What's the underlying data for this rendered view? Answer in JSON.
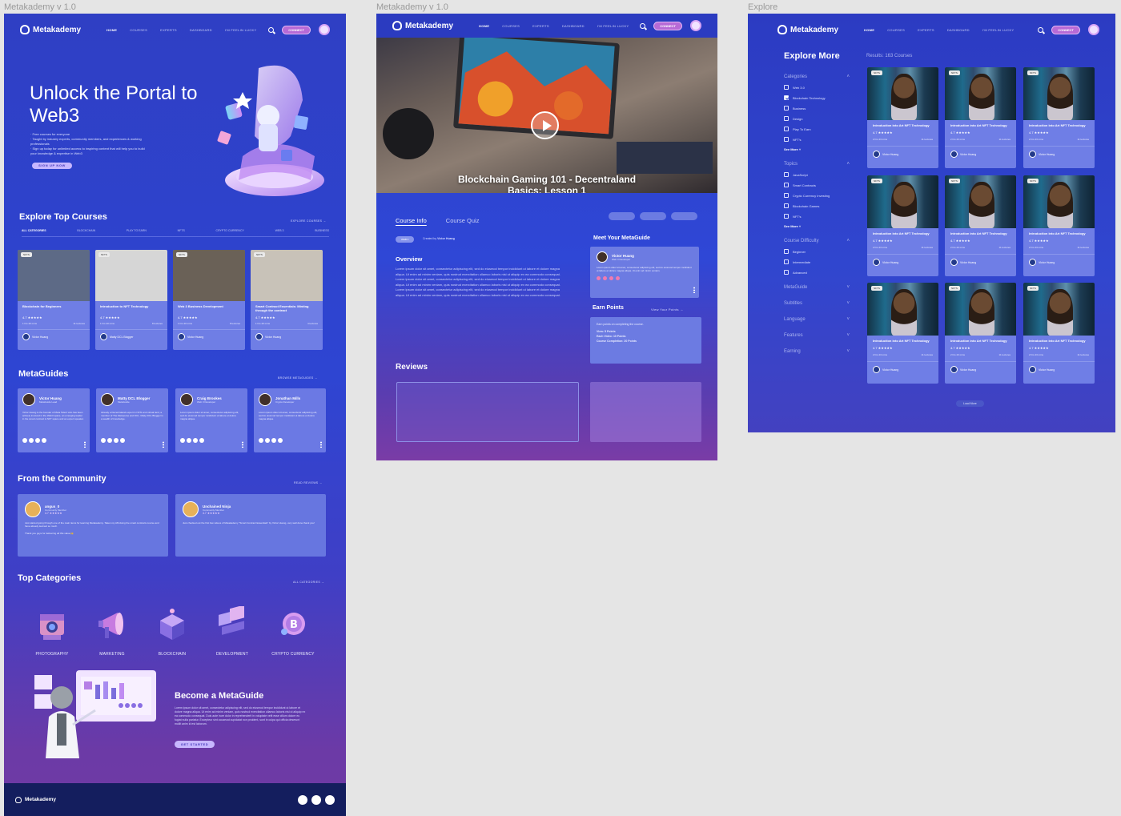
{
  "frames": {
    "home_label": "Metakademy v 1.0",
    "course_label": "Metakademy v 1.0",
    "explore_label": "Explore"
  },
  "nav": {
    "brand": "Metakademy",
    "links": [
      "HOME",
      "COURSES",
      "EXPERTS",
      "DASHBOARD",
      "I'M FEELIN LUCKY"
    ],
    "connect": "CONNECT"
  },
  "hero": {
    "title": "Unlock the Portal to Web3",
    "bullets": [
      "Free courses for everyone",
      "Taught by industry experts, community members, and experiences & working professionals",
      "Sign up today for unlimited access to inspiring content that will help you to build your knowledge & expertise in Web3"
    ],
    "cta": "SIGN UP NOW"
  },
  "top_courses": {
    "title": "Explore Top Courses",
    "link": "EXPLORE COURSES →",
    "tabs": [
      "ALL CATEGORIES",
      "BLOCKCHAIN",
      "PLAY TO EARN",
      "NFTS",
      "CRYPTO CURRENCY",
      "WEB 3",
      "BUSINESS"
    ],
    "cards": [
      {
        "tag": "NFTS",
        "title": "Blockchain for Beginners",
        "rating": "4.7 ★★★★★",
        "duration": "1 hrs 20 mins",
        "lectures": "11 lectures",
        "author": "Victor Huang",
        "thumb": "#5d6a86"
      },
      {
        "tag": "NFTS",
        "title": "Introduction to NFT Technology",
        "rating": "4.7 ★★★★★",
        "duration": "1 hrs 20 mins",
        "lectures": "8 lectures",
        "author": "Matty DCL Blogger",
        "thumb": "#d6d6d6"
      },
      {
        "tag": "NFTS",
        "title": "Web 3 Business Development",
        "rating": "4.7 ★★★★★",
        "duration": "1 hrs 20 mins",
        "lectures": "8 lectures",
        "author": "Victor Huang",
        "thumb": "#6a6157"
      },
      {
        "tag": "NFTS",
        "title": "Smart Contract Essentials: Minting through the contract",
        "rating": "4.7 ★★★★★",
        "duration": "1 hrs 20 mins",
        "lectures": "4 lectures",
        "author": "Victor Huang",
        "thumb": "#c8c2b8"
      }
    ]
  },
  "metaguides": {
    "title": "MetaGuides",
    "link": "BROWSE METAGUIDES →",
    "cards": [
      {
        "name": "Victor Huang",
        "sub": "MetaGuide Lead",
        "body": "Victor Huang is the founder of Meta Talent who has been actively involved in the Web3 space, an emerging leader in the smart contract & NFT space and an expert speaker."
      },
      {
        "name": "Matty DCL Blogger",
        "sub": "MetaGuide",
        "body": "Already a Decentraland expert in NFTs and virtual land, a member of The Metaverse and DCL. Matty DCL Blogger is a wealth of knowledge."
      },
      {
        "name": "Craig Brookes",
        "sub": "Web 3 Developer",
        "body": "Lorem ipsum dolor sit amet, consectetur adipiscing elit, sed do eiusmod tempor incididunt ut labore et dolore magna aliqua."
      },
      {
        "name": "Jonathan Mills",
        "sub": "Crypto Developer",
        "body": "Lorem ipsum dolor sit amet, consectetur adipiscing elit, sed do eiusmod tempor incididunt ut labore et dolore magna aliqua."
      }
    ]
  },
  "community": {
    "title": "From the Community",
    "link": "READ REVIEWS →",
    "reviews": [
      {
        "name": "angus_0",
        "sub": "Community Member",
        "rating": "4.7 ★★★★★",
        "body": "Just started going through one of the main items for learning Metakademy. Taken my AM doing the smart contracts course and have already learned so much.",
        "extra": "Thank you guys for delivering all this value 🙌"
      },
      {
        "name": "Unchained Ninja",
        "sub": "Community Member",
        "rating": "4.7 ★★★★★",
        "body": "Just checked out the first few videos of Metakademy \"Smart Contract Essentials\" by Victor Huang, very well done thank you!",
        "extra": ""
      }
    ]
  },
  "categories": {
    "title": "Top Categories",
    "link": "ALL CATEGORIES →",
    "items": [
      "PHOTOGRAPHY",
      "MARKETING",
      "BLOCKCHAIN",
      "DEVELOPMENT",
      "CRYPTO CURRENCY"
    ]
  },
  "become": {
    "title": "Become a MetaGuide",
    "body": "Lorem ipsum dolor sit amet, consectetur adipiscing elit, sed do eiusmod tempor incididunt ut labore et dolore magna aliqua. Ut enim ad minim veniam, quis nostrud exercitation ullamco laboris nisi ut aliquip ex ea commodo consequat. Duis aute irure dolor in reprehenderit in voluptate velit esse cillum dolore eu fugiat nulla pariatur. Excepteur sint occaecat cupidatat non proident, sunt in culpa qui officia deserunt mollit anim id est laborum.",
    "cta": "GET STARTED"
  },
  "footer": {
    "brand": "Metakademy"
  },
  "course_page": {
    "video_title": "Blockchain Gaming 101 - Decentraland Basics: Lesson 1",
    "tabs": [
      "Course Info",
      "Course Quiz"
    ],
    "tag": "WEB 3",
    "created_by": "Created by",
    "creator": "Victor Huang",
    "overview_title": "Overview",
    "overview": "Lorem ipsum dolor sit amet, consectetur adipiscing elit, sed do eiusmod tempor incididunt ut labore et dolore magna aliqua. Ut enim ad minim veniam, quis nostrud exercitation ullamco laboris nisi ut aliquip ex ea commodo consequat. Lorem ipsum dolor sit amet, consectetur adipiscing elit, sed do eiusmod tempor incididunt ut labore et dolore magna aliqua. Ut enim ad minim veniam, quis nostrud exercitation ullamco laboris nisi ut aliquip ex ea commodo consequat. Lorem ipsum dolor sit amet, consectetur adipiscing elit, sed do eiusmod tempor incididunt ut labore et dolore magna aliqua. Ut enim ad minim veniam, quis nostrud exercitation ullamco laboris nisi ut aliquip ex ea commodo consequat.",
    "meet_title": "Meet Your MetaGuide",
    "guide_name": "Victor Huang",
    "guide_sub": "Web 3 Developer",
    "guide_body": "Lorem ipsum dolor sit amet, consectetur adipiscing elit, sed do eiusmod tempor incididunt ut labore et dolore magna aliqua. Ut enim ad minim veniam.",
    "earn_title": "Earn Points",
    "earn_link": "View Your Points →",
    "earn_intro": "Earn points on completing the course.",
    "earn_view": "View: 5 Points",
    "earn_video": "Each Video: 10 Points",
    "earn_complete": "Course Completion: 20 Points",
    "reviews_title": "Reviews"
  },
  "explore": {
    "title": "Explore More",
    "results": "Results: 163 Courses",
    "categories_title": "Categories",
    "categories": [
      "Web 3.0",
      "Blockchain Technology",
      "Business",
      "Design",
      "Play To Earn",
      "NFT's"
    ],
    "topics_title": "Topics",
    "topics": [
      "JavaScript",
      "Smart Contracts",
      "Crypto Currency Investing",
      "Blockchain Games",
      "NFT's"
    ],
    "see_more": "See More",
    "difficulty_title": "Course Difficulty",
    "difficulty": [
      "Beginner",
      "Intermediate",
      "Advanced"
    ],
    "collapsed": [
      "MetaGuide",
      "Subtitles",
      "Language",
      "Features",
      "Earning"
    ],
    "card": {
      "tag": "NFTS",
      "title": "Introduction into Art NFT Technology",
      "rating": "4.7 ★★★★★",
      "duration": "2 hrs 23 mins",
      "lectures": "11 lectures",
      "author": "Victor Huang"
    },
    "load_more": "Load More"
  }
}
